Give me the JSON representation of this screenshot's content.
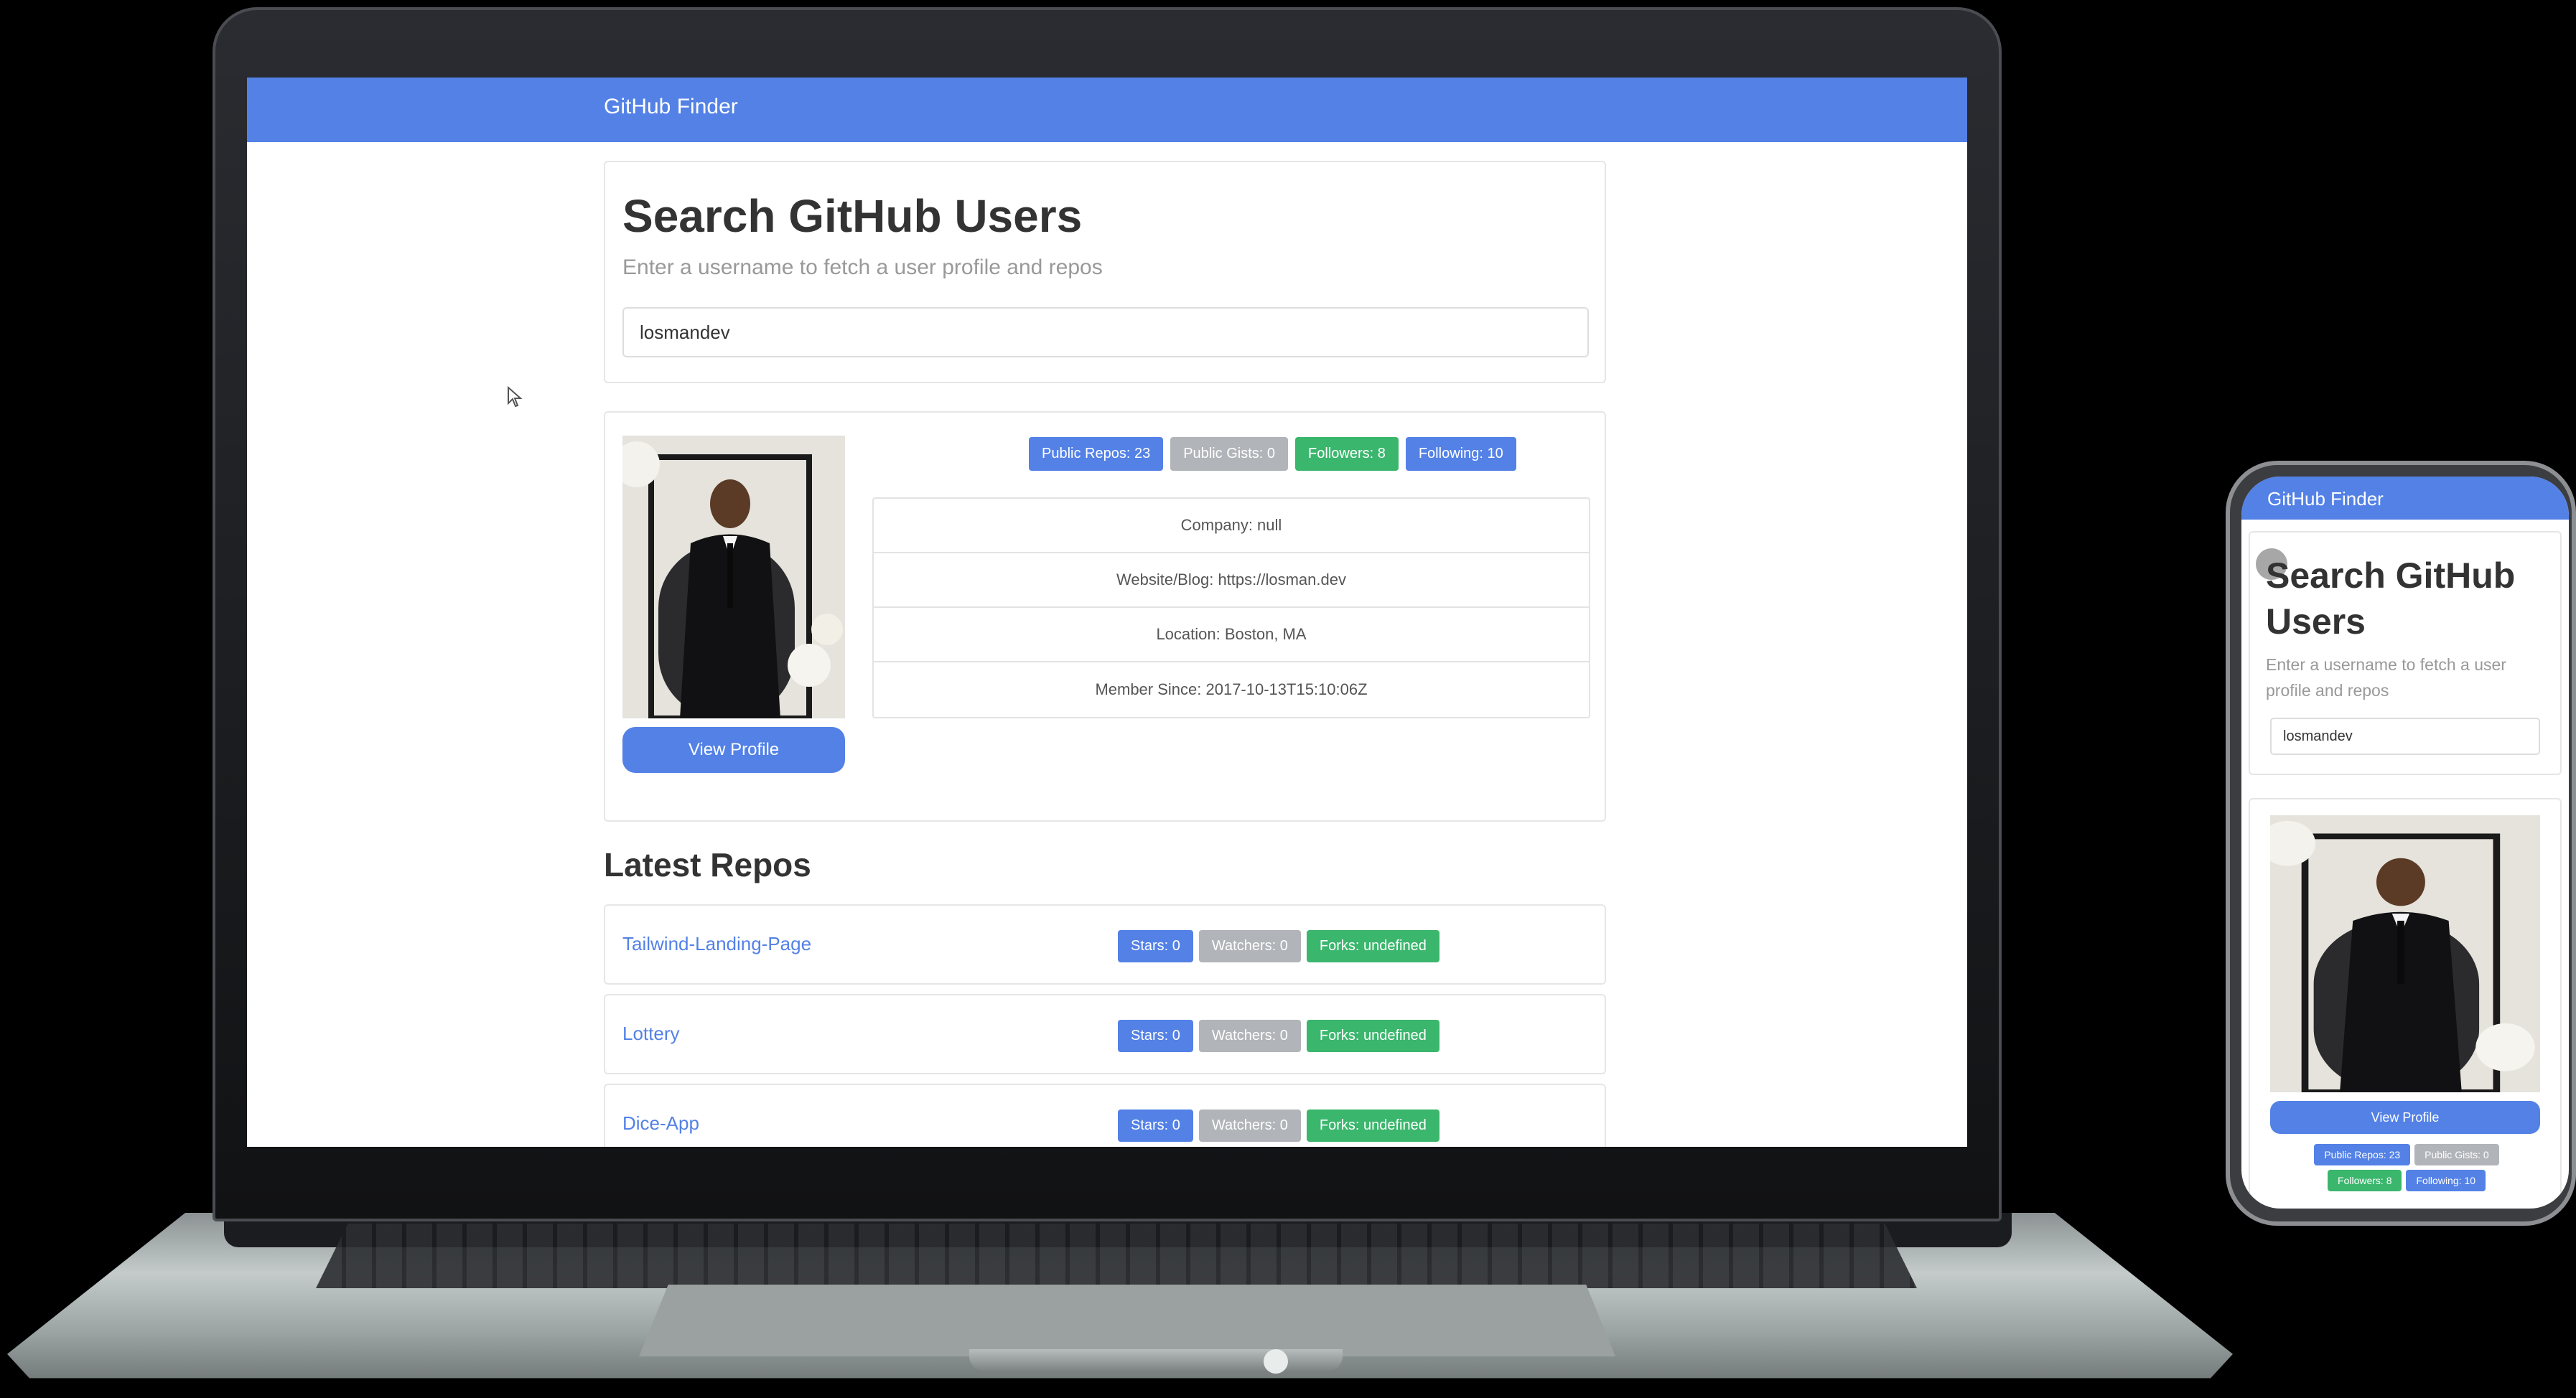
{
  "app": {
    "brand": "GitHub Finder"
  },
  "search": {
    "title": "Search GitHub Users",
    "lead": "Enter a username to fetch a user profile and repos",
    "value": "losmandev"
  },
  "profile": {
    "view_profile_label": "View Profile",
    "badges": {
      "public_repos": "Public Repos: 23",
      "public_gists": "Public Gists: 0",
      "followers": "Followers: 8",
      "following": "Following: 10"
    },
    "details": {
      "company": "Company: null",
      "website": "Website/Blog: https://losman.dev",
      "location": "Location: Boston, MA",
      "member_since": "Member Since: 2017-10-13T15:10:06Z"
    }
  },
  "repos": {
    "title": "Latest Repos",
    "items": [
      {
        "name": "Tailwind-Landing-Page",
        "stars": "Stars: 0",
        "watchers": "Watchers: 0",
        "forks": "Forks: undefined"
      },
      {
        "name": "Lottery",
        "stars": "Stars: 0",
        "watchers": "Watchers: 0",
        "forks": "Forks: undefined"
      },
      {
        "name": "Dice-App",
        "stars": "Stars: 0",
        "watchers": "Watchers: 0",
        "forks": "Forks: undefined"
      }
    ]
  },
  "colors": {
    "primary": "#5381e6",
    "grey": "#b1b4b8",
    "green": "#3bb66d"
  },
  "icons": {
    "cursor": "mouse-pointer-icon"
  }
}
